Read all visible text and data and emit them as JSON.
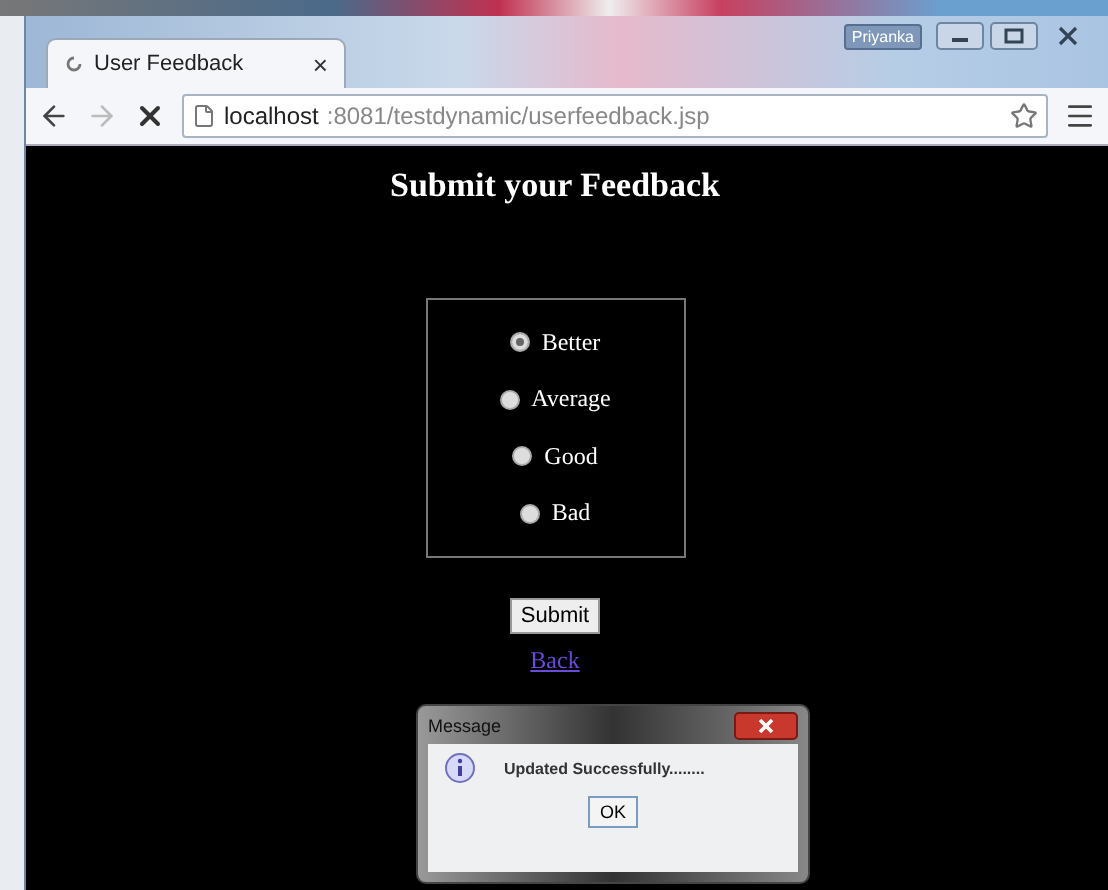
{
  "window": {
    "user": "Priyanka"
  },
  "tab": {
    "title": "User Feedback",
    "close": "×"
  },
  "address_bar": {
    "host": "localhost",
    "path": ":8081/testdynamic/userfeedback.jsp"
  },
  "page": {
    "heading": "Submit your Feedback",
    "options": [
      {
        "label": "Better",
        "selected": true
      },
      {
        "label": "Average",
        "selected": false
      },
      {
        "label": "Good",
        "selected": false
      },
      {
        "label": "Bad",
        "selected": false
      }
    ],
    "submit": "Submit",
    "back_link": "Back"
  },
  "dialog": {
    "title": "Message",
    "message": "Updated Successfully........",
    "button": "OK"
  }
}
